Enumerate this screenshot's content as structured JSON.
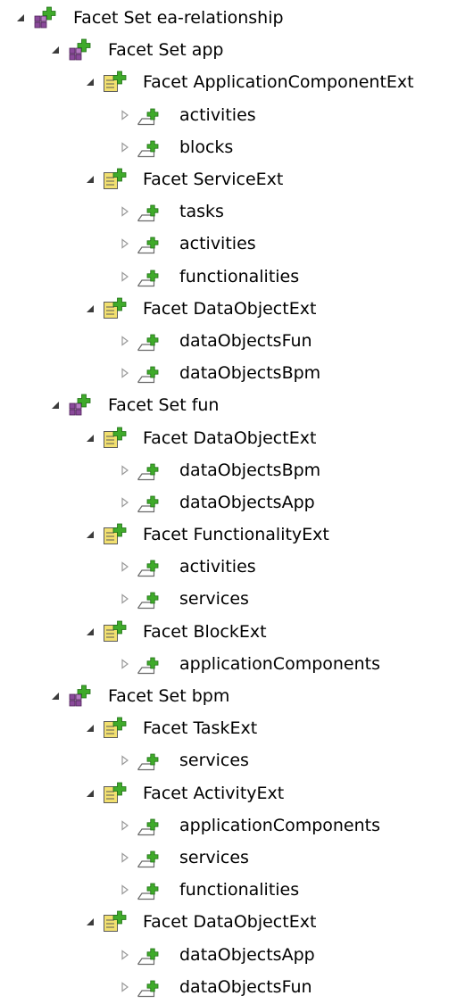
{
  "colors": {
    "plus_green": "#3faa2a",
    "facetset_purple": "#8a4a9a",
    "facet_yellow": "#f2e070",
    "reference_outline": "#6a6a6a",
    "twisty_expanded": "#3c3c3c",
    "twisty_collapsed": "#9a9a9a"
  },
  "tree": [
    {
      "depth": 0,
      "type": "facet-set",
      "expanded": true,
      "icon": "facet-set-icon",
      "label": "Facet Set ea-relationship"
    },
    {
      "depth": 1,
      "type": "facet-set",
      "expanded": true,
      "icon": "facet-set-icon",
      "label": "Facet Set app"
    },
    {
      "depth": 2,
      "type": "facet",
      "expanded": true,
      "icon": "facet-icon",
      "label": "Facet ApplicationComponentExt"
    },
    {
      "depth": 3,
      "type": "reference",
      "expanded": false,
      "icon": "reference-icon",
      "label": "activities"
    },
    {
      "depth": 3,
      "type": "reference",
      "expanded": false,
      "icon": "reference-icon",
      "label": "blocks"
    },
    {
      "depth": 2,
      "type": "facet",
      "expanded": true,
      "icon": "facet-icon",
      "label": "Facet ServiceExt"
    },
    {
      "depth": 3,
      "type": "reference",
      "expanded": false,
      "icon": "reference-icon",
      "label": "tasks"
    },
    {
      "depth": 3,
      "type": "reference",
      "expanded": false,
      "icon": "reference-icon",
      "label": "activities"
    },
    {
      "depth": 3,
      "type": "reference",
      "expanded": false,
      "icon": "reference-icon",
      "label": "functionalities"
    },
    {
      "depth": 2,
      "type": "facet",
      "expanded": true,
      "icon": "facet-icon",
      "label": "Facet DataObjectExt"
    },
    {
      "depth": 3,
      "type": "reference",
      "expanded": false,
      "icon": "reference-icon",
      "label": "dataObjectsFun"
    },
    {
      "depth": 3,
      "type": "reference",
      "expanded": false,
      "icon": "reference-icon",
      "label": "dataObjectsBpm"
    },
    {
      "depth": 1,
      "type": "facet-set",
      "expanded": true,
      "icon": "facet-set-icon",
      "label": "Facet Set fun"
    },
    {
      "depth": 2,
      "type": "facet",
      "expanded": true,
      "icon": "facet-icon",
      "label": "Facet DataObjectExt"
    },
    {
      "depth": 3,
      "type": "reference",
      "expanded": false,
      "icon": "reference-icon",
      "label": "dataObjectsBpm"
    },
    {
      "depth": 3,
      "type": "reference",
      "expanded": false,
      "icon": "reference-icon",
      "label": "dataObjectsApp"
    },
    {
      "depth": 2,
      "type": "facet",
      "expanded": true,
      "icon": "facet-icon",
      "label": "Facet FunctionalityExt"
    },
    {
      "depth": 3,
      "type": "reference",
      "expanded": false,
      "icon": "reference-icon",
      "label": "activities"
    },
    {
      "depth": 3,
      "type": "reference",
      "expanded": false,
      "icon": "reference-icon",
      "label": "services"
    },
    {
      "depth": 2,
      "type": "facet",
      "expanded": true,
      "icon": "facet-icon",
      "label": "Facet BlockExt"
    },
    {
      "depth": 3,
      "type": "reference",
      "expanded": false,
      "icon": "reference-icon",
      "label": "applicationComponents"
    },
    {
      "depth": 1,
      "type": "facet-set",
      "expanded": true,
      "icon": "facet-set-icon",
      "label": "Facet Set bpm"
    },
    {
      "depth": 2,
      "type": "facet",
      "expanded": true,
      "icon": "facet-icon",
      "label": "Facet TaskExt"
    },
    {
      "depth": 3,
      "type": "reference",
      "expanded": false,
      "icon": "reference-icon",
      "label": "services"
    },
    {
      "depth": 2,
      "type": "facet",
      "expanded": true,
      "icon": "facet-icon",
      "label": "Facet ActivityExt"
    },
    {
      "depth": 3,
      "type": "reference",
      "expanded": false,
      "icon": "reference-icon",
      "label": "applicationComponents"
    },
    {
      "depth": 3,
      "type": "reference",
      "expanded": false,
      "icon": "reference-icon",
      "label": "services"
    },
    {
      "depth": 3,
      "type": "reference",
      "expanded": false,
      "icon": "reference-icon",
      "label": "functionalities"
    },
    {
      "depth": 2,
      "type": "facet",
      "expanded": true,
      "icon": "facet-icon",
      "label": "Facet DataObjectExt"
    },
    {
      "depth": 3,
      "type": "reference",
      "expanded": false,
      "icon": "reference-icon",
      "label": "dataObjectsApp"
    },
    {
      "depth": 3,
      "type": "reference",
      "expanded": false,
      "icon": "reference-icon",
      "label": "dataObjectsFun"
    }
  ]
}
